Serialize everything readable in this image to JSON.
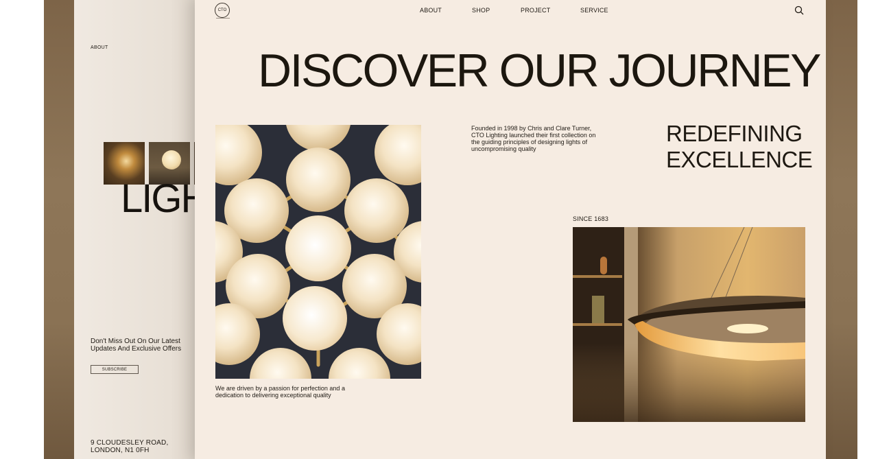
{
  "back_page": {
    "about": "ABOUT",
    "big_text": "LIGH",
    "offer": "Don't Miss Out On Our Latest Updates And Exclusive Offers",
    "subscribe_label": "SUBSCRIBE",
    "address_line1": "9 CLOUDESLEY ROAD,",
    "address_line2": "LONDON, N1 0FH"
  },
  "header": {
    "logo_text": "CTO",
    "nav": [
      "ABOUT",
      "SHOP",
      "PROJECT",
      "SERVICE"
    ]
  },
  "main": {
    "headline": "DISCOVER OUR JOURNEY",
    "caption_left": "We are driven by a passion for perfection and a dedication to delivering exceptional quality",
    "founded_text": "Founded in 1998 by Chris and Clare Turner, CTO Lighting launched their first collection on the guiding principles of designing lights of uncompromising quality",
    "redefine_line1": "REDEFINING",
    "redefine_line2": "EXCELLENCE",
    "since": "SINCE 1683"
  },
  "colors": {
    "page_bg": "#f6ece2",
    "frame_bg": "#8a7254",
    "text": "#1c170f"
  },
  "icons": {
    "search": "search-icon",
    "logo": "logo-icon"
  }
}
